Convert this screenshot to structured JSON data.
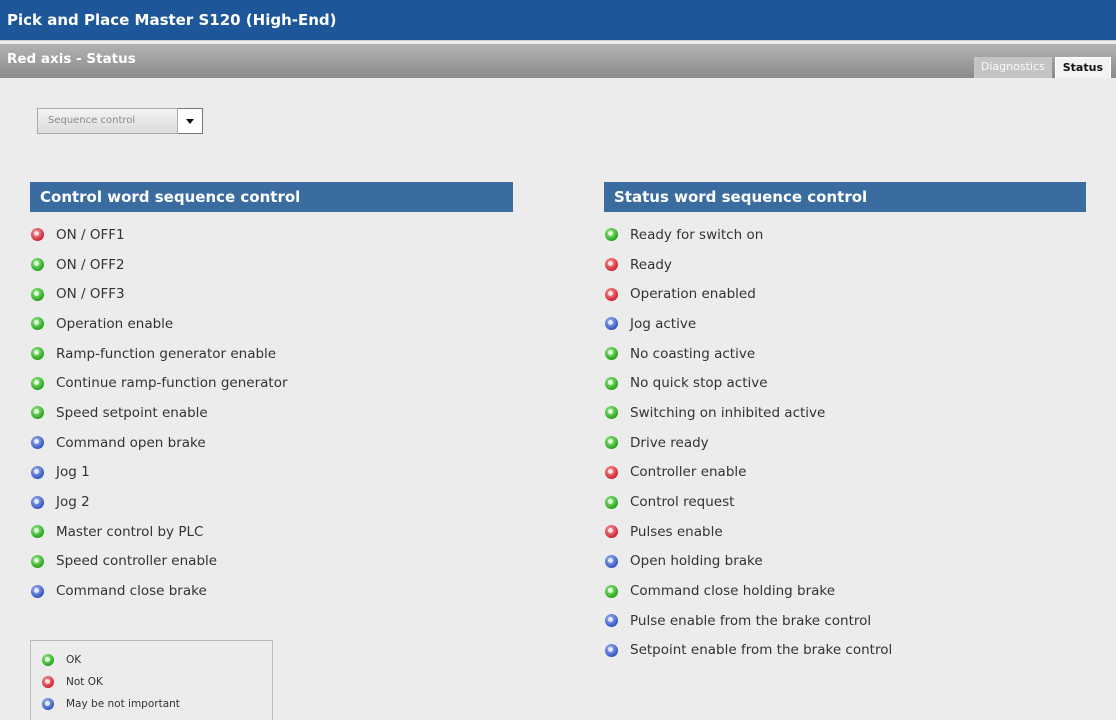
{
  "app": {
    "title": "Pick and Place Master S120 (High-End)"
  },
  "page": {
    "subtitle": "Red axis - Status"
  },
  "tabs": [
    {
      "label": "Diagnostics",
      "active": false
    },
    {
      "label": "Status",
      "active": true
    }
  ],
  "dropdown": {
    "value": "Sequence control"
  },
  "control_panel": {
    "header": "Control word sequence control",
    "items": [
      {
        "label": "ON / OFF1",
        "state": "red"
      },
      {
        "label": "ON / OFF2",
        "state": "green"
      },
      {
        "label": "ON / OFF3",
        "state": "green"
      },
      {
        "label": "Operation enable",
        "state": "green"
      },
      {
        "label": "Ramp-function generator enable",
        "state": "green"
      },
      {
        "label": "Continue ramp-function generator",
        "state": "green"
      },
      {
        "label": "Speed setpoint enable",
        "state": "green"
      },
      {
        "label": "Command open brake",
        "state": "blue"
      },
      {
        "label": "Jog 1",
        "state": "blue"
      },
      {
        "label": "Jog 2",
        "state": "blue"
      },
      {
        "label": "Master control by PLC",
        "state": "green"
      },
      {
        "label": "Speed controller enable",
        "state": "green"
      },
      {
        "label": "Command close brake",
        "state": "blue"
      }
    ]
  },
  "status_panel": {
    "header": "Status word sequence control",
    "items": [
      {
        "label": "Ready for switch on",
        "state": "green"
      },
      {
        "label": "Ready",
        "state": "red"
      },
      {
        "label": "Operation enabled",
        "state": "red"
      },
      {
        "label": "Jog active",
        "state": "blue"
      },
      {
        "label": "No coasting active",
        "state": "green"
      },
      {
        "label": "No quick stop active",
        "state": "green"
      },
      {
        "label": "Switching on inhibited active",
        "state": "green"
      },
      {
        "label": "Drive ready",
        "state": "green"
      },
      {
        "label": "Controller enable",
        "state": "red"
      },
      {
        "label": "Control request",
        "state": "green"
      },
      {
        "label": "Pulses enable",
        "state": "red"
      },
      {
        "label": "Open holding brake",
        "state": "blue"
      },
      {
        "label": "Command close holding brake",
        "state": "green"
      },
      {
        "label": "Pulse enable from the brake control",
        "state": "blue"
      },
      {
        "label": "Setpoint enable from the brake control",
        "state": "blue"
      }
    ]
  },
  "legend": {
    "items": [
      {
        "label": "OK",
        "state": "green"
      },
      {
        "label": "Not OK",
        "state": "red"
      },
      {
        "label": "May be not important",
        "state": "blue"
      }
    ]
  },
  "colors": {
    "titlebar": "#1d5799",
    "panel_header": "#3a6c9f",
    "ok": "#28a51c",
    "not_ok": "#d42433",
    "neutral": "#3357c4"
  },
  "icons": {
    "dropdown_arrow": "chevron-down-icon",
    "status_led": "status-led-icon"
  }
}
